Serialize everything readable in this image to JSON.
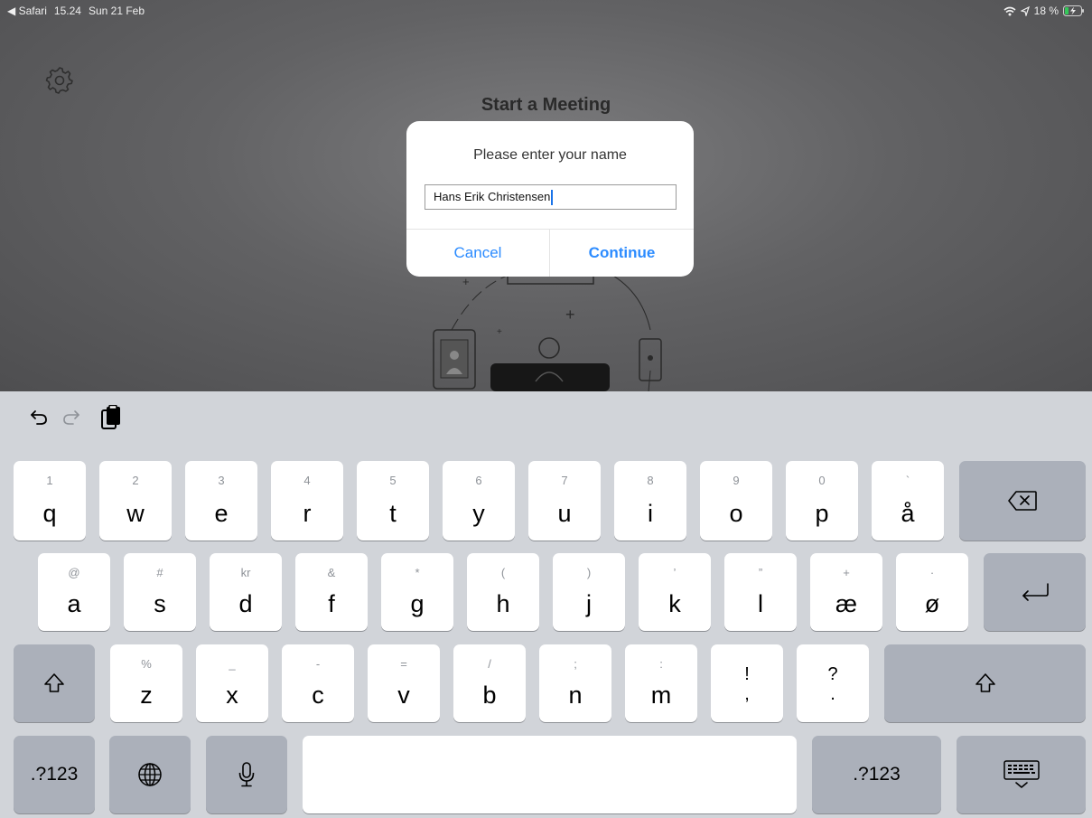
{
  "status_bar": {
    "back_label": "◀ Safari",
    "time": "15.24",
    "date": "Sun 21 Feb",
    "battery": "18 %"
  },
  "app": {
    "title": "Start a Meeting"
  },
  "dialog": {
    "message": "Please enter your name",
    "input_value": "Hans Erik Christensen",
    "cancel_label": "Cancel",
    "continue_label": "Continue"
  },
  "keyboard": {
    "row1": [
      {
        "main": "q",
        "hint": "1"
      },
      {
        "main": "w",
        "hint": "2"
      },
      {
        "main": "e",
        "hint": "3"
      },
      {
        "main": "r",
        "hint": "4"
      },
      {
        "main": "t",
        "hint": "5"
      },
      {
        "main": "y",
        "hint": "6"
      },
      {
        "main": "u",
        "hint": "7"
      },
      {
        "main": "i",
        "hint": "8"
      },
      {
        "main": "o",
        "hint": "9"
      },
      {
        "main": "p",
        "hint": "0"
      },
      {
        "main": "å",
        "hint": "`"
      }
    ],
    "row2": [
      {
        "main": "a",
        "hint": "@"
      },
      {
        "main": "s",
        "hint": "#"
      },
      {
        "main": "d",
        "hint": "kr"
      },
      {
        "main": "f",
        "hint": "&"
      },
      {
        "main": "g",
        "hint": "*"
      },
      {
        "main": "h",
        "hint": "("
      },
      {
        "main": "j",
        "hint": ")"
      },
      {
        "main": "k",
        "hint": "’"
      },
      {
        "main": "l",
        "hint": "”"
      },
      {
        "main": "æ",
        "hint": "+"
      },
      {
        "main": "ø",
        "hint": "·"
      }
    ],
    "row3": [
      {
        "main": "z",
        "hint": "%"
      },
      {
        "main": "x",
        "hint": "_"
      },
      {
        "main": "c",
        "hint": "-"
      },
      {
        "main": "v",
        "hint": "="
      },
      {
        "main": "b",
        "hint": "/"
      },
      {
        "main": "n",
        "hint": ";"
      },
      {
        "main": "m",
        "hint": ":"
      }
    ],
    "row3_punct": [
      {
        "top": "!",
        "bottom": ","
      },
      {
        "top": "?",
        "bottom": "."
      }
    ],
    "numbers_label_left": ".?123",
    "numbers_label_right": ".?123"
  }
}
